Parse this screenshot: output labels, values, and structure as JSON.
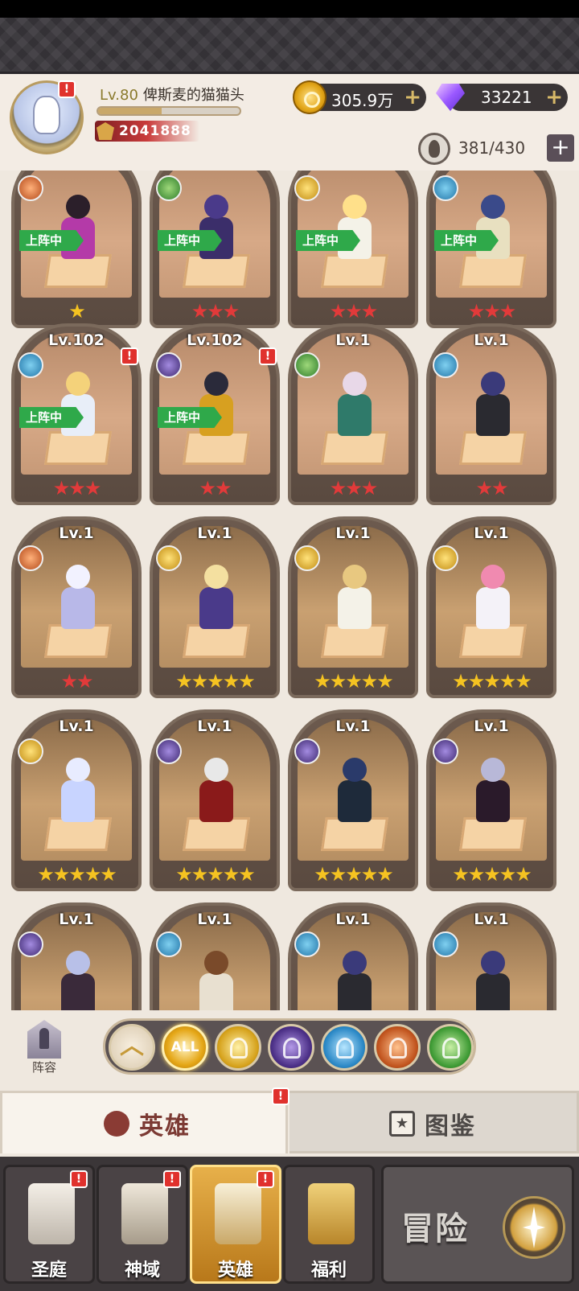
{
  "player": {
    "level": "Lv.80",
    "name": "俾斯麦的猫猫头",
    "xp_fraction": 0.45,
    "power": "2041888"
  },
  "currencies": {
    "gold": "305.9万",
    "gems": "33221",
    "hero_slots": "381/430"
  },
  "heroes": [
    {
      "level": "",
      "faction": "fire",
      "deployed": true,
      "deploy_label": "上阵中",
      "stars": 1,
      "star_color": "purple"
    },
    {
      "level": "",
      "faction": "nature",
      "deployed": true,
      "deploy_label": "上阵中",
      "stars": 3,
      "star_color": "red"
    },
    {
      "level": "",
      "faction": "light",
      "deployed": true,
      "deploy_label": "上阵中",
      "stars": 3,
      "star_color": "red"
    },
    {
      "level": "",
      "faction": "water",
      "deployed": true,
      "deploy_label": "上阵中",
      "stars": 3,
      "star_color": "red"
    },
    {
      "level": "Lv.102",
      "faction": "water",
      "deployed": true,
      "deploy_label": "上阵中",
      "stars": 3,
      "star_color": "red",
      "alert": true
    },
    {
      "level": "Lv.102",
      "faction": "dark",
      "deployed": true,
      "deploy_label": "上阵中",
      "stars": 2,
      "star_color": "red",
      "alert": true
    },
    {
      "level": "Lv.1",
      "faction": "nature",
      "deployed": false,
      "stars": 3,
      "star_color": "red"
    },
    {
      "level": "Lv.1",
      "faction": "water",
      "deployed": false,
      "stars": 2,
      "star_color": "red"
    },
    {
      "level": "Lv.1",
      "faction": "fire",
      "deployed": false,
      "stars": 2,
      "star_color": "red"
    },
    {
      "level": "Lv.1",
      "faction": "light",
      "deployed": false,
      "stars": 5,
      "star_color": "gold"
    },
    {
      "level": "Lv.1",
      "faction": "light",
      "deployed": false,
      "stars": 5,
      "star_color": "gold"
    },
    {
      "level": "Lv.1",
      "faction": "light",
      "deployed": false,
      "stars": 5,
      "star_color": "gold"
    },
    {
      "level": "Lv.1",
      "faction": "light",
      "deployed": false,
      "stars": 5,
      "star_color": "gold"
    },
    {
      "level": "Lv.1",
      "faction": "dark",
      "deployed": false,
      "stars": 5,
      "star_color": "gold"
    },
    {
      "level": "Lv.1",
      "faction": "dark",
      "deployed": false,
      "stars": 5,
      "star_color": "gold"
    },
    {
      "level": "Lv.1",
      "faction": "dark",
      "deployed": false,
      "stars": 5,
      "star_color": "gold"
    },
    {
      "level": "Lv.1",
      "faction": "dark",
      "deployed": false,
      "stars": 0,
      "star_color": "gold"
    },
    {
      "level": "Lv.1",
      "faction": "water",
      "deployed": false,
      "stars": 0,
      "star_color": "gold"
    },
    {
      "level": "Lv.1",
      "faction": "water",
      "deployed": false,
      "stars": 0,
      "star_color": "gold"
    },
    {
      "level": "Lv.1",
      "faction": "water",
      "deployed": false,
      "stars": 0,
      "star_color": "gold"
    }
  ],
  "filters": {
    "lineup_label": "阵容",
    "all_label": "ALL",
    "items": [
      "up",
      "all",
      "light",
      "dark",
      "water",
      "fire",
      "nature"
    ]
  },
  "tabs": {
    "heroes": "英雄",
    "codex": "图鉴"
  },
  "nav": {
    "items": [
      {
        "label": "圣庭",
        "icon": "castle-icon",
        "alert": true
      },
      {
        "label": "神域",
        "icon": "shrine-icon",
        "alert": true
      },
      {
        "label": "英雄",
        "icon": "helmet-icon",
        "alert": true,
        "active": true
      },
      {
        "label": "福利",
        "icon": "chest-icon",
        "alert": false
      }
    ],
    "adventure": "冒险"
  },
  "badge_symbol": "!",
  "colors": {
    "deploy_green": "#2fa94a",
    "alert_red": "#e0312d",
    "star_red": "#e23a3a",
    "star_gold": "#f5c321"
  }
}
